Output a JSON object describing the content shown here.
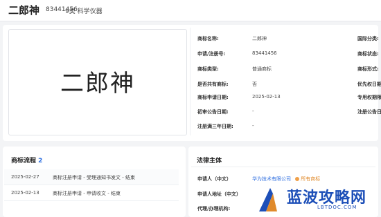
{
  "header": {
    "title": "二郎神",
    "reg_no": "83441456",
    "class": "9类 科学仪器"
  },
  "logo": {
    "text": "二郎神"
  },
  "details": [
    {
      "label": "商标名称:",
      "value": "二郎神"
    },
    {
      "label": "申请/注册号:",
      "value": "83441456"
    },
    {
      "label": "商标类型:",
      "value": "普通商标"
    },
    {
      "label": "是否共有商标:",
      "value": "否"
    },
    {
      "label": "商标申请日期:",
      "value": "2025-02-13"
    },
    {
      "label": "初审公告日期:",
      "value": "-"
    },
    {
      "label": "注册满三年日期:",
      "value": "-"
    }
  ],
  "right_col": [
    {
      "label": "国际分类:"
    },
    {
      "label": "商标状态:"
    },
    {
      "label": "商标形式:"
    },
    {
      "label": "优先权日期"
    },
    {
      "label": "专用权期限"
    },
    {
      "label": "注册公告日"
    }
  ],
  "flow": {
    "title": "商标流程",
    "count": "2",
    "items": [
      {
        "date": "2025-02-27",
        "text": "商标注册申请 - 受理通知书发文 - 结束"
      },
      {
        "date": "2025-02-13",
        "text": "商标注册申请 - 申请收文 - 结束"
      }
    ]
  },
  "legal": {
    "title": "法律主体",
    "applicant_label": "申请人（中文）",
    "applicant_value": "华为技术有限公司",
    "applicant_badge": "所有商标",
    "address_label": "申请人地址（中文）",
    "agent_label": "代理/办理机构:"
  },
  "watermark": {
    "cn": "蓝波攻略网",
    "en": "LBTDOC.COM"
  }
}
